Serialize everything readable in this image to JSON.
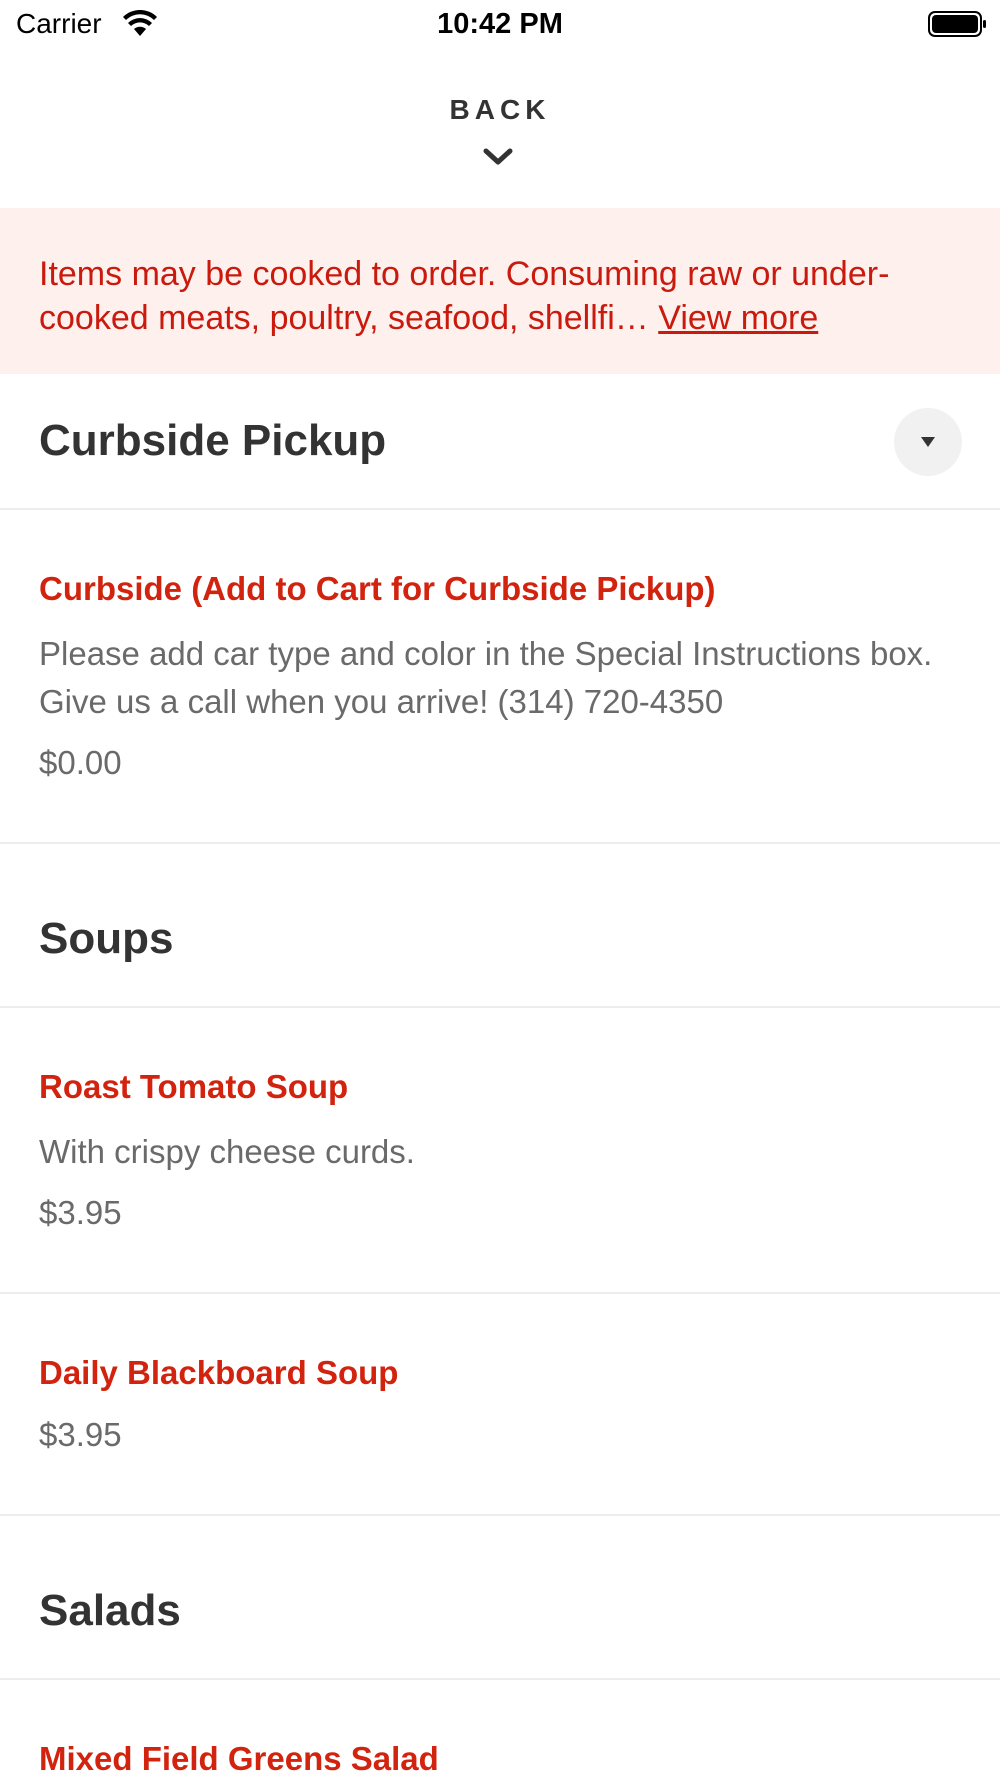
{
  "status_bar": {
    "carrier": "Carrier",
    "time": "10:42 PM"
  },
  "header": {
    "back_label": "BACK"
  },
  "disclaimer": {
    "text": "Items may be cooked to order. Consuming raw or under-cooked meats, poultry, seafood, shellfi…",
    "link": "View more"
  },
  "sections": [
    {
      "title": "Curbside Pickup",
      "items": [
        {
          "name": "Curbside (Add to Cart for Curbside Pickup)",
          "description": "Please add car type and color in the Special Instructions box. Give us a call when you arrive! (314) 720-4350",
          "price": "$0.00"
        }
      ]
    },
    {
      "title": "Soups",
      "items": [
        {
          "name": "Roast Tomato Soup",
          "description": "With crispy cheese curds.",
          "price": "$3.95"
        },
        {
          "name": "Daily Blackboard Soup",
          "price": "$3.95"
        }
      ]
    },
    {
      "title": "Salads",
      "items": [
        {
          "name": "Mixed Field Greens Salad"
        }
      ]
    }
  ],
  "colors": {
    "accent": "#d2230f",
    "disclaimer_bg": "#fdf0ed",
    "disclaimer_text": "#c91a0d",
    "muted_text": "#6a6a6a"
  },
  "icons": {
    "wifi": "wifi-icon",
    "battery": "battery-icon",
    "back": "chevron-down-icon",
    "collapse": "caret-down-icon"
  }
}
